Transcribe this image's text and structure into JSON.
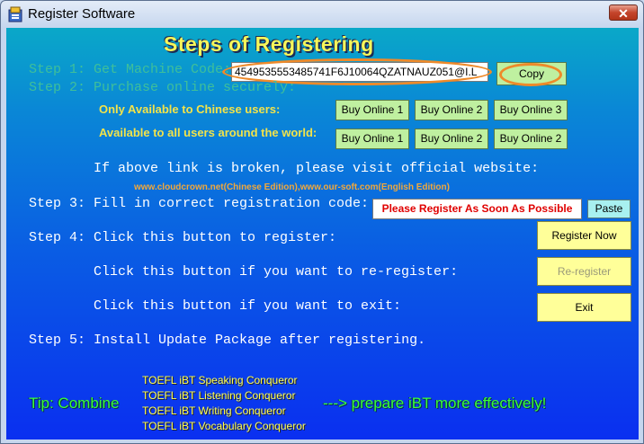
{
  "window": {
    "title": "Register Software",
    "close_label": "✕"
  },
  "heading": "Steps of Registering",
  "step1": {
    "label": "Step 1: Get Machine Code:",
    "machine_code": "4549535553485741F6J10064QZATNAUZ051@I.L",
    "copy_label": "Copy"
  },
  "step2": {
    "label": "Step 2: Purchase online securely:",
    "chinese_label": "Only Available to Chinese users:",
    "world_label": "Available to all users around the world:",
    "chinese_buttons": [
      "Buy Online 1",
      "Buy Online 2",
      "Buy Online 3"
    ],
    "world_buttons": [
      "Buy Online 1",
      "Buy Online 2",
      "Buy Online 2"
    ],
    "broken_link_text": "If above link is broken, please visit official website:",
    "websites": "www.cloudcrown.net(Chinese Edition),www.our-soft.com(English Edition)"
  },
  "step3": {
    "label": "Step 3: Fill in correct registration code:",
    "code_placeholder": "Please Register As Soon As Possible",
    "paste_label": "Paste"
  },
  "step4": {
    "label": "Step 4: Click this button to register:",
    "register_label": "Register Now",
    "reregister_text": "Click this button if you want to re-register:",
    "reregister_label": "Re-register",
    "exit_text": "Click this button if you want to exit:",
    "exit_label": "Exit"
  },
  "step5": {
    "label": "Step 5: Install Update Package after registering."
  },
  "tip": {
    "prefix": "Tip:  Combine",
    "suffix": "---> prepare iBT more effectively!",
    "products": [
      "TOEFL iBT  Speaking Conqueror",
      "TOEFL iBT  Listening Conqueror",
      "TOEFL iBT  Writing  Conqueror",
      "TOEFL iBT Vocabulary Conqueror"
    ]
  },
  "colors": {
    "accent_orange": "#ee8a2a",
    "heading_yellow": "#f7f75a",
    "tip_green": "#39ff39",
    "error_red": "#e00000"
  }
}
